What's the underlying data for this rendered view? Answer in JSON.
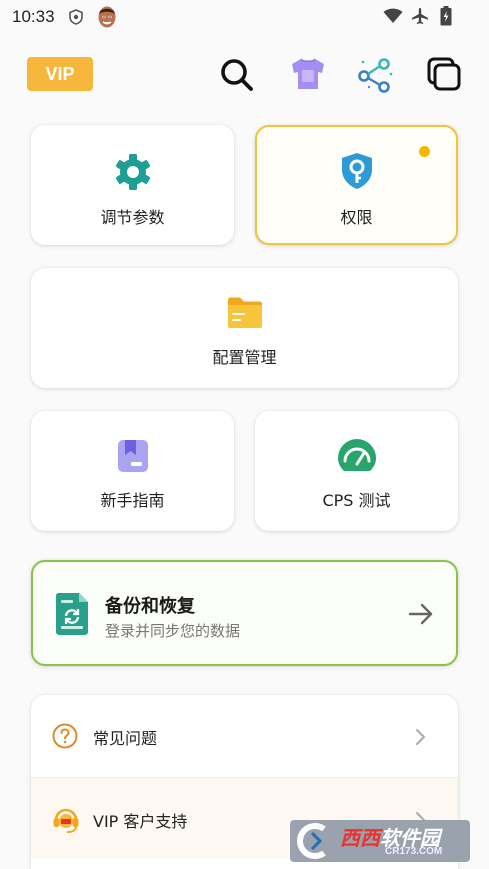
{
  "status_bar": {
    "time": "10:33"
  },
  "header": {
    "vip_label": "VIP",
    "icons": [
      "search-icon",
      "theme-shirt-icon",
      "share-icon",
      "copy-windows-icon"
    ]
  },
  "cards": {
    "adjust": {
      "label": "调节参数",
      "icon": "gear-icon"
    },
    "permission": {
      "label": "权限",
      "icon": "shield-key-icon"
    },
    "config": {
      "label": "配置管理",
      "icon": "folder-icon"
    },
    "guide": {
      "label": "新手指南",
      "icon": "bookmark-book-icon"
    },
    "cps": {
      "label": "CPS 测试",
      "icon": "speedometer-icon"
    }
  },
  "backup": {
    "title": "备份和恢复",
    "subtitle": "登录并同步您的数据",
    "icon": "sync-document-icon"
  },
  "list": [
    {
      "label": "常见问题",
      "icon": "question-icon"
    },
    {
      "label": "VIP 客户支持",
      "icon": "headset-icon"
    }
  ],
  "watermark": {
    "title_a": "西西",
    "title_b": "软件园",
    "sub": "CR173.COM"
  },
  "colors": {
    "accent_yellow": "#f6b73c",
    "permission_border": "#f3c33a",
    "backup_border": "#8bc34a",
    "teal": "#2aa59a",
    "gauge_green": "#27a56a",
    "purple": "#9b8cf0"
  }
}
